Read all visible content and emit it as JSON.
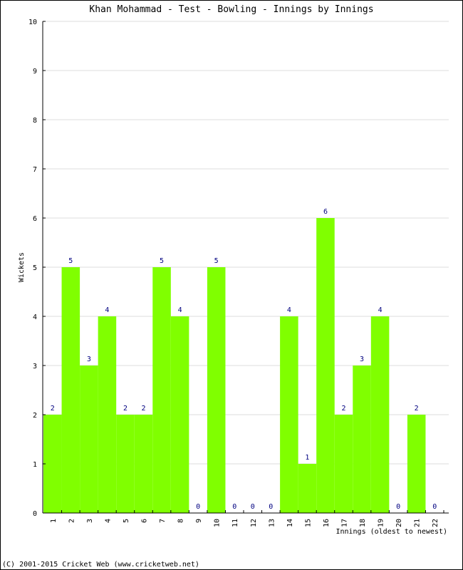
{
  "chart_data": {
    "type": "bar",
    "title": "Khan Mohammad - Test - Bowling - Innings by Innings",
    "xlabel": "Innings (oldest to newest)",
    "ylabel": "Wickets",
    "ylim": [
      0,
      10
    ],
    "yticks": [
      "0",
      "1",
      "2",
      "3",
      "4",
      "5",
      "6",
      "7",
      "8",
      "9",
      "10"
    ],
    "grid": true,
    "categories": [
      "1",
      "2",
      "3",
      "4",
      "5",
      "6",
      "7",
      "8",
      "9",
      "10",
      "11",
      "12",
      "13",
      "14",
      "15",
      "16",
      "17",
      "18",
      "19",
      "20",
      "21",
      "22"
    ],
    "values": [
      2,
      5,
      3,
      4,
      2,
      2,
      5,
      4,
      0,
      5,
      0,
      0,
      0,
      4,
      1,
      6,
      2,
      3,
      4,
      0,
      2,
      0
    ],
    "bar_color": "#80ff00",
    "value_label_color": "#000080",
    "gridline_color": "#dddddd"
  },
  "footer": {
    "copyright": "(C) 2001-2015 Cricket Web (www.cricketweb.net)"
  }
}
